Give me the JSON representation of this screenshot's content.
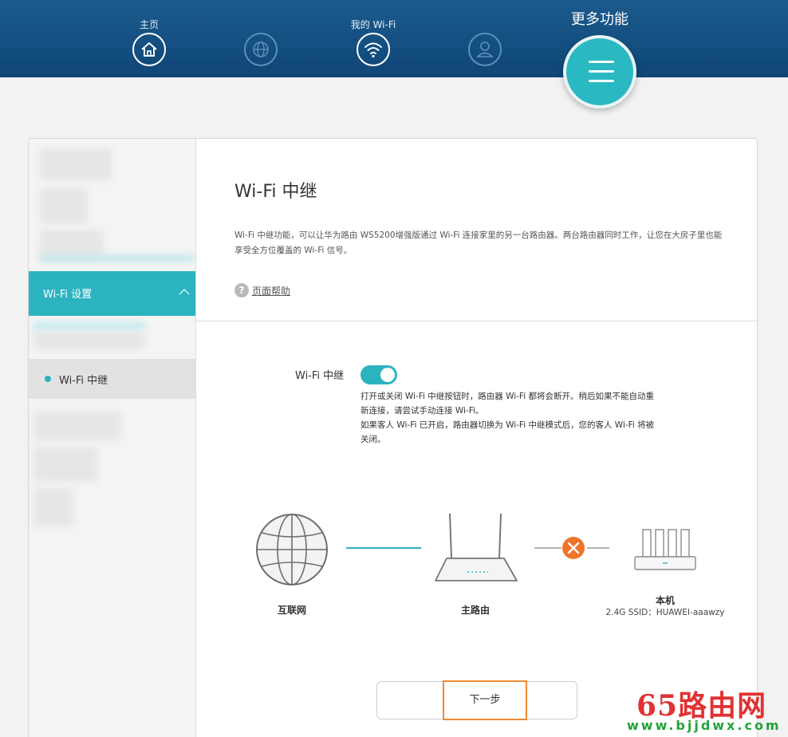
{
  "nav": {
    "home_label": "主页",
    "wifi_label": "我的 Wi-Fi",
    "more_label": "更多功能"
  },
  "sidebar": {
    "group_label": "Wi-Fi 设置",
    "active_item_label": "Wi-Fi 中继"
  },
  "main": {
    "title": "Wi-Fi 中继",
    "description": "Wi-Fi 中继功能，可以让华为路由 WS5200增强版通过 Wi-Fi 连接家里的另一台路由器。两台路由器同时工作，让您在大房子里也能享受全方位覆盖的 Wi-Fi 信号。",
    "help_label": "页面帮助",
    "toggle_label": "Wi-Fi 中继",
    "toggle_on": true,
    "hint_line1": "打开或关闭 Wi-Fi 中继按钮时，路由器 Wi-Fi 都将会断开。稍后如果不能自动重新连接，请尝试手动连接 Wi-Fi。",
    "hint_line2": "如果客人 Wi-Fi 已开启，路由器切换为 Wi-Fi 中继模式后，您的客人 Wi-Fi 将被关闭。"
  },
  "diagram": {
    "internet_label": "互联网",
    "main_router_label": "主路由",
    "local_label": "本机",
    "local_ssid": "2.4G SSID：HUAWEI-aaawzy",
    "line_color": "#2bb3c0",
    "disconnected_color": "#f0742a"
  },
  "actions": {
    "next_label": "下一步"
  },
  "watermark": {
    "main": "65路由网",
    "sub": "www.bjjdwx.com"
  },
  "colors": {
    "header": "#134f80",
    "accent": "#2bb3c0",
    "highlight_border": "#ef8a33"
  }
}
